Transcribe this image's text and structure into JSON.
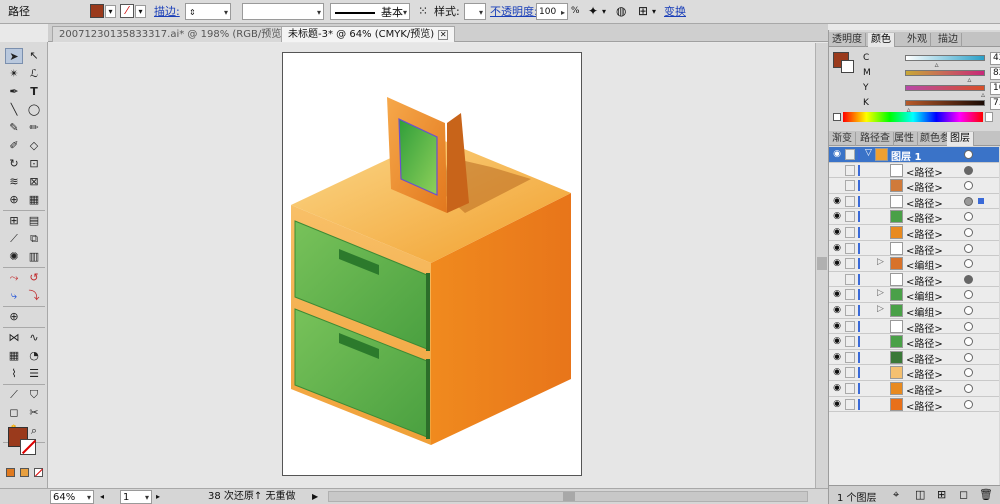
{
  "control_bar": {
    "object_type": "路径",
    "fill_color": "#9a3a1c",
    "stroke_label": "描边:",
    "stroke_style": "基本",
    "style_label": "样式:",
    "opacity_label": "不透明度:",
    "opacity_value": "100",
    "opacity_unit": "%",
    "transform_label": "变换"
  },
  "tabs": [
    {
      "label": "20071230135833317.ai* @ 198% (RGB/预览)",
      "active": false
    },
    {
      "label": "未标题-3* @ 64% (CMYK/预览)",
      "active": true
    }
  ],
  "color_panel": {
    "tabs": [
      "透明度",
      "颜色",
      "外观",
      "描边"
    ],
    "active_tab": "颜色",
    "sliders": [
      {
        "channel": "C",
        "value": "42.19",
        "unit": "%",
        "level": 0.42,
        "color": "#2aa0c8"
      },
      {
        "channel": "M",
        "value": "82.81",
        "unit": "%",
        "level": 0.83,
        "color": "#c8287a"
      },
      {
        "channel": "Y",
        "value": "100",
        "unit": "%",
        "level": 1.0,
        "color": "#d8c820"
      },
      {
        "channel": "K",
        "value": "7.42",
        "unit": "%",
        "level": 0.07,
        "color": "#444444"
      }
    ]
  },
  "layers_panel": {
    "tabs": [
      "渐变",
      "路径查",
      "属性",
      "颜色参",
      "图层"
    ],
    "active_tab": "图层",
    "layer_name": "图层 1",
    "rows": [
      {
        "name": "<路径>",
        "eye": false,
        "twirl": "",
        "thumb": "#ffffff",
        "target": "filled"
      },
      {
        "name": "<路径>",
        "eye": false,
        "twirl": "",
        "thumb": "#d07a3a",
        "target": "empty"
      },
      {
        "name": "<路径>",
        "eye": true,
        "twirl": "",
        "thumb": "#ffffff",
        "target": "selected"
      },
      {
        "name": "<路径>",
        "eye": true,
        "twirl": "",
        "thumb": "#4aa048",
        "target": "empty"
      },
      {
        "name": "<路径>",
        "eye": true,
        "twirl": "",
        "thumb": "#e88a20",
        "target": "empty"
      },
      {
        "name": "<路径>",
        "eye": true,
        "twirl": "",
        "thumb": "#ffffff",
        "target": "empty"
      },
      {
        "name": "<编组>",
        "eye": true,
        "twirl": "▷",
        "thumb": "#d8722a",
        "target": "empty"
      },
      {
        "name": "<路径>",
        "eye": false,
        "twirl": "",
        "thumb": "#ffffff",
        "target": "filled"
      },
      {
        "name": "<编组>",
        "eye": true,
        "twirl": "▷",
        "thumb": "#4aa048",
        "target": "empty"
      },
      {
        "name": "<编组>",
        "eye": true,
        "twirl": "▷",
        "thumb": "#4aa048",
        "target": "empty"
      },
      {
        "name": "<路径>",
        "eye": true,
        "twirl": "",
        "thumb": "#ffffff",
        "target": "empty"
      },
      {
        "name": "<路径>",
        "eye": true,
        "twirl": "",
        "thumb": "#4aa048",
        "target": "empty"
      },
      {
        "name": "<路径>",
        "eye": true,
        "twirl": "",
        "thumb": "#3a7838",
        "target": "empty"
      },
      {
        "name": "<路径>",
        "eye": true,
        "twirl": "",
        "thumb": "#f4c070",
        "target": "empty"
      },
      {
        "name": "<路径>",
        "eye": true,
        "twirl": "",
        "thumb": "#e88a20",
        "target": "empty"
      },
      {
        "name": "<路径>",
        "eye": true,
        "twirl": "",
        "thumb": "#e8701a",
        "target": "empty"
      }
    ],
    "footer": "1 个图层"
  },
  "status_bar": {
    "zoom": "64%",
    "artboard": "1",
    "history": "38 次还原↑ 无重做"
  }
}
